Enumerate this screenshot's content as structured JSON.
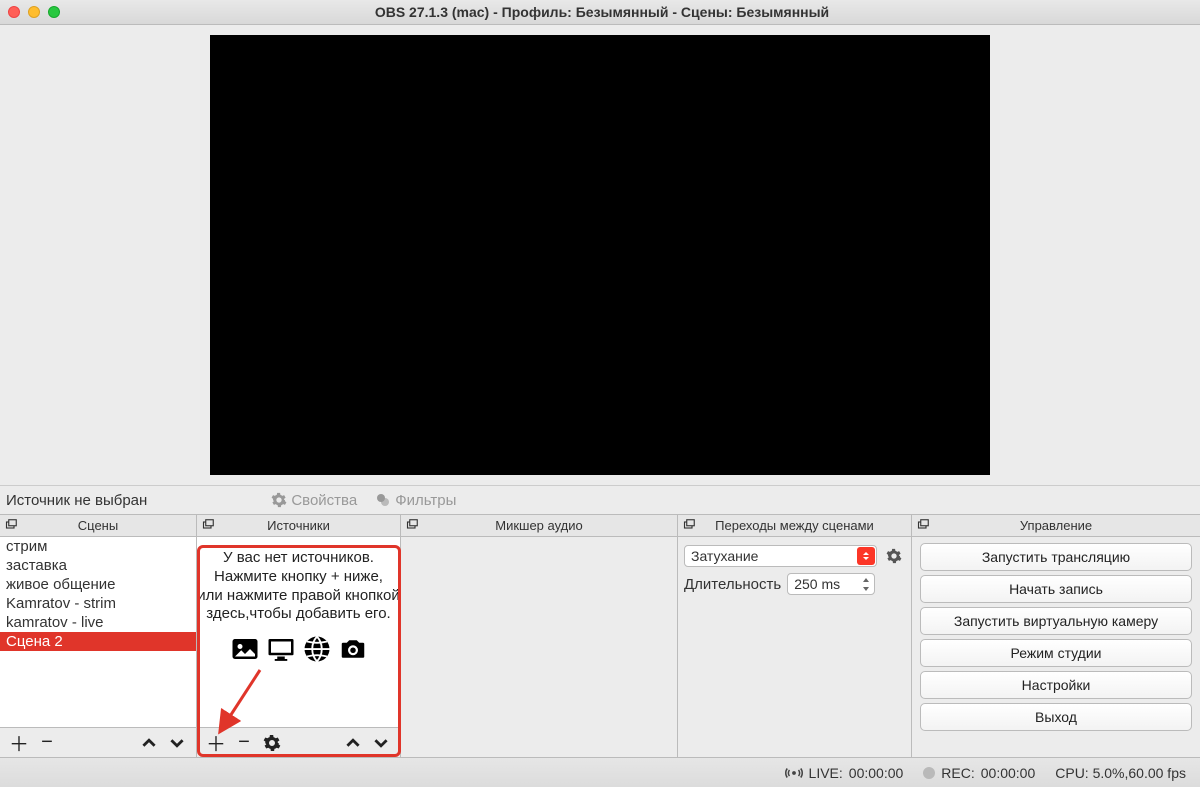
{
  "window": {
    "title": "OBS 27.1.3 (mac) - Профиль: Безымянный - Сцены: Безымянный"
  },
  "midbar": {
    "selection_label": "Источник не выбран",
    "properties_label": "Свойства",
    "filters_label": "Фильтры"
  },
  "docks": {
    "scenes": {
      "title": "Сцены",
      "items": [
        {
          "label": "стрим",
          "selected": false
        },
        {
          "label": "заставка",
          "selected": false
        },
        {
          "label": "живое общение",
          "selected": false
        },
        {
          "label": "Kamratov - strim",
          "selected": false
        },
        {
          "label": "kamratov - live",
          "selected": false
        },
        {
          "label": "Сцена 2",
          "selected": true
        }
      ]
    },
    "sources": {
      "title": "Источники",
      "empty_line1": "У вас нет источников.",
      "empty_line2": "Нажмите кнопку + ниже,",
      "empty_line3": "или нажмите правой кнопкой",
      "empty_line4": "здесь,чтобы добавить его."
    },
    "mixer": {
      "title": "Микшер аудио"
    },
    "transitions": {
      "title": "Переходы между сценами",
      "select_value": "Затухание",
      "duration_label": "Длительность",
      "duration_value": "250 ms"
    },
    "controls": {
      "title": "Управление",
      "buttons": {
        "stream": "Запустить трансляцию",
        "record": "Начать запись",
        "virtualcam": "Запустить виртуальную камеру",
        "studio": "Режим студии",
        "settings": "Настройки",
        "exit": "Выход"
      }
    }
  },
  "statusbar": {
    "live_label": "LIVE:",
    "live_time": "00:00:00",
    "rec_label": "REC:",
    "rec_time": "00:00:00",
    "cpu_label": "CPU: 5.0%,60.00 fps"
  }
}
